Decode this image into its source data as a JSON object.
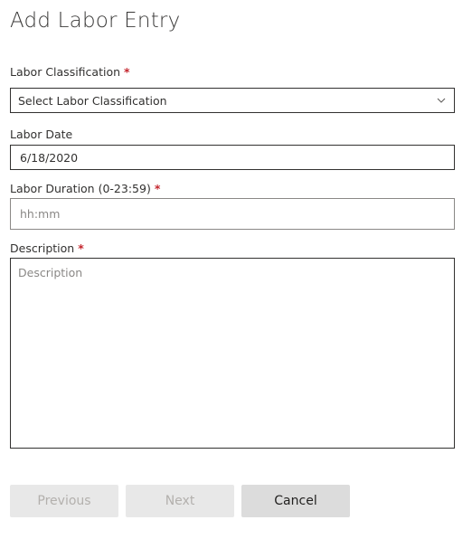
{
  "form": {
    "title": "Add Labor Entry",
    "required_marker": "*",
    "classification": {
      "label": "Labor Classification",
      "selected": "Select Labor Classification"
    },
    "date": {
      "label": "Labor Date",
      "value": "6/18/2020"
    },
    "duration": {
      "label": "Labor Duration (0-23:59)",
      "placeholder": "hh:mm",
      "value": ""
    },
    "description": {
      "label": "Description",
      "placeholder": "Description",
      "value": ""
    }
  },
  "buttons": {
    "previous": "Previous",
    "next": "Next",
    "cancel": "Cancel"
  },
  "colors": {
    "required": "#c4262e",
    "button_bg": "#e1dfdd",
    "disabled_text": "#b3b0ad"
  },
  "icons": {
    "dropdown": "chevron-down-icon"
  }
}
